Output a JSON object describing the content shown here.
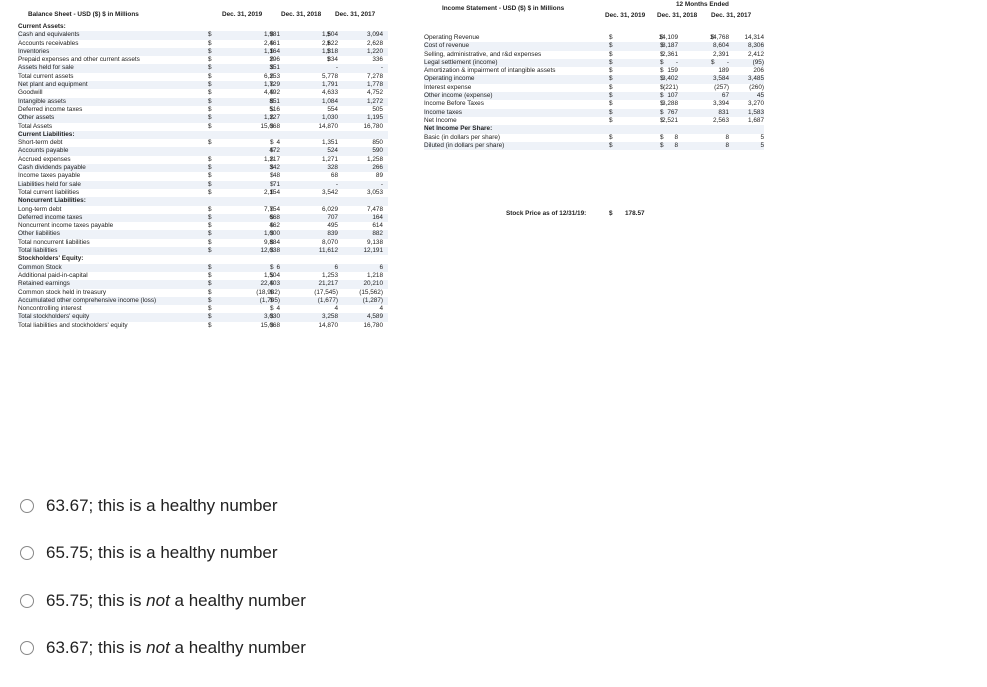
{
  "balance_sheet": {
    "title": "Balance Sheet - USD ($) $ in Millions",
    "columns": [
      "Dec. 31, 2019",
      "Dec. 31, 2018",
      "Dec. 31, 2017"
    ],
    "rows": [
      {
        "label": "Current Assets:",
        "section": true
      },
      {
        "label": "Cash and equivalents",
        "d": [
          "$",
          "$",
          "$"
        ],
        "v": [
          "1,981",
          "1,504",
          "3,094"
        ]
      },
      {
        "label": "Accounts receivables",
        "d": [
          "$",
          "$",
          "$"
        ],
        "v": [
          "2,461",
          "2,622",
          "2,628"
        ]
      },
      {
        "label": "Inventories",
        "d": [
          "$",
          "$",
          "$"
        ],
        "v": [
          "1,164",
          "1,318",
          "1,220"
        ]
      },
      {
        "label": "Prepaid expenses and other current assets",
        "d": [
          "$",
          "$",
          "$"
        ],
        "v": [
          "296",
          "334",
          "336"
        ]
      },
      {
        "label": "Assets held for sale",
        "d": [
          "$",
          "$",
          ""
        ],
        "v": [
          "351",
          "-",
          "-"
        ]
      },
      {
        "label": "Total current assets",
        "d": [
          "$",
          "$",
          ""
        ],
        "v": [
          "6,253",
          "5,778",
          "7,278"
        ]
      },
      {
        "label": "Net plant and equipment",
        "d": [
          "$",
          "$",
          ""
        ],
        "v": [
          "1,729",
          "1,791",
          "1,778"
        ]
      },
      {
        "label": "Goodwill",
        "d": [
          "$",
          "$",
          ""
        ],
        "v": [
          "4,492",
          "4,633",
          "4,752"
        ]
      },
      {
        "label": "Intangible assets",
        "d": [
          "$",
          "$",
          ""
        ],
        "v": [
          "851",
          "1,084",
          "1,272"
        ]
      },
      {
        "label": "Deferred income taxes",
        "d": [
          "$",
          "$",
          ""
        ],
        "v": [
          "516",
          "554",
          "505"
        ]
      },
      {
        "label": "Other assets",
        "d": [
          "$",
          "$",
          ""
        ],
        "v": [
          "1,227",
          "1,030",
          "1,195"
        ]
      },
      {
        "label": "Total Assets",
        "d": [
          "$",
          "$",
          ""
        ],
        "v": [
          "15,068",
          "14,870",
          "16,780"
        ]
      },
      {
        "label": "Current Liabilities:",
        "section": true
      },
      {
        "label": "Short-term debt",
        "d": [
          "$",
          "$",
          ""
        ],
        "v": [
          "4",
          "1,351",
          "850"
        ]
      },
      {
        "label": "Accounts payable",
        "d": [
          "",
          "$",
          ""
        ],
        "v": [
          "472",
          "524",
          "590"
        ]
      },
      {
        "label": "Accrued expenses",
        "d": [
          "$",
          "$",
          ""
        ],
        "v": [
          "1,217",
          "1,271",
          "1,258"
        ]
      },
      {
        "label": "Cash dividends payable",
        "d": [
          "$",
          "$",
          ""
        ],
        "v": [
          "342",
          "328",
          "266"
        ]
      },
      {
        "label": "Income taxes payable",
        "d": [
          "$",
          "$",
          ""
        ],
        "v": [
          "48",
          "68",
          "89"
        ]
      },
      {
        "label": "Liabilities held for sale",
        "d": [
          "$",
          "$",
          ""
        ],
        "v": [
          "71",
          "-",
          "-"
        ]
      },
      {
        "label": "Total current liabilities",
        "d": [
          "$",
          "$",
          ""
        ],
        "v": [
          "2,154",
          "3,542",
          "3,053"
        ]
      },
      {
        "label": "Noncurrent Liabilities:",
        "section": true
      },
      {
        "label": "Long-term debt",
        "d": [
          "$",
          "$",
          ""
        ],
        "v": [
          "7,754",
          "6,029",
          "7,478"
        ]
      },
      {
        "label": "Deferred income taxes",
        "d": [
          "$",
          "$",
          ""
        ],
        "v": [
          "668",
          "707",
          "164"
        ]
      },
      {
        "label": "Noncurrent income taxes payable",
        "d": [
          "$",
          "$",
          ""
        ],
        "v": [
          "462",
          "495",
          "614"
        ]
      },
      {
        "label": "Other liabilities",
        "d": [
          "$",
          "$",
          ""
        ],
        "v": [
          "1,000",
          "839",
          "882"
        ]
      },
      {
        "label": "Total noncurrent liabilities",
        "d": [
          "$",
          "$",
          ""
        ],
        "v": [
          "9,884",
          "8,070",
          "9,138"
        ]
      },
      {
        "label": "Total liabilities",
        "d": [
          "$",
          "$",
          ""
        ],
        "v": [
          "12,038",
          "11,612",
          "12,191"
        ]
      },
      {
        "label": "Stockholders' Equity:",
        "section": true
      },
      {
        "label": "Common Stock",
        "d": [
          "$",
          "$",
          ""
        ],
        "v": [
          "6",
          "6",
          "6"
        ]
      },
      {
        "label": "Additional paid-in-capital",
        "d": [
          "$",
          "$",
          ""
        ],
        "v": [
          "1,504",
          "1,253",
          "1,218"
        ]
      },
      {
        "label": "Retained earnings",
        "d": [
          "$",
          "$",
          ""
        ],
        "v": [
          "22,403",
          "21,217",
          "20,210"
        ]
      },
      {
        "label": "Common stock held in treasury",
        "d": [
          "$",
          "$",
          ""
        ],
        "v": [
          "(18,982)",
          "(17,545)",
          "(15,562)"
        ]
      },
      {
        "label": "Accumulated other comprehensive income (loss)",
        "d": [
          "$",
          "$",
          ""
        ],
        "v": [
          "(1,705)",
          "(1,677)",
          "(1,287)"
        ]
      },
      {
        "label": "Noncontrolling interest",
        "d": [
          "$",
          "$",
          ""
        ],
        "v": [
          "4",
          "4",
          "4"
        ]
      },
      {
        "label": "Total stockholders' equity",
        "d": [
          "$",
          "$",
          ""
        ],
        "v": [
          "3,030",
          "3,258",
          "4,589"
        ]
      },
      {
        "label": "Total liabilities and stockholders' equity",
        "d": [
          "$",
          "$",
          ""
        ],
        "v": [
          "15,068",
          "14,870",
          "16,780"
        ]
      }
    ]
  },
  "income_statement": {
    "title": "Income Statement - USD ($) $ in Millions",
    "period_header": "12 Months Ended",
    "columns": [
      "Dec. 31, 2019",
      "Dec. 31, 2018",
      "Dec. 31, 2017"
    ],
    "rows": [
      {
        "label": "Operating Revenue",
        "d": [
          "$",
          "$",
          "$"
        ],
        "v": [
          "14,109",
          "14,768",
          "14,314"
        ]
      },
      {
        "label": "Cost of revenue",
        "d": [
          "$",
          "$",
          ""
        ],
        "v": [
          "8,187",
          "8,604",
          "8,306"
        ]
      },
      {
        "label": "Selling, administrative, and r&d expenses",
        "d": [
          "$",
          "$",
          ""
        ],
        "v": [
          "2,361",
          "2,391",
          "2,412"
        ]
      },
      {
        "label": "Legal settlement (income)",
        "d": [
          "$",
          "$",
          "$"
        ],
        "v": [
          "-",
          "-",
          "(95)"
        ]
      },
      {
        "label": "Amortization & impairment of intangible assets",
        "d": [
          "$",
          "$",
          ""
        ],
        "v": [
          "159",
          "189",
          "206"
        ]
      },
      {
        "label": "Operating income",
        "d": [
          "$",
          "$",
          ""
        ],
        "v": [
          "3,402",
          "3,584",
          "3,485"
        ]
      },
      {
        "label": "Interest expense",
        "d": [
          "$",
          "$",
          ""
        ],
        "v": [
          "(221)",
          "(257)",
          "(260)"
        ]
      },
      {
        "label": "Other income (expense)",
        "d": [
          "$",
          "$",
          ""
        ],
        "v": [
          "107",
          "67",
          "45"
        ]
      },
      {
        "label": "Income Before Taxes",
        "d": [
          "$",
          "$",
          ""
        ],
        "v": [
          "3,288",
          "3,394",
          "3,270"
        ]
      },
      {
        "label": "Income taxes",
        "d": [
          "$",
          "$",
          ""
        ],
        "v": [
          "767",
          "831",
          "1,583"
        ]
      },
      {
        "label": "Net Income",
        "d": [
          "$",
          "$",
          ""
        ],
        "v": [
          "2,521",
          "2,563",
          "1,687"
        ]
      },
      {
        "label": "Net Income Per Share:",
        "section": true
      },
      {
        "label": "Basic (in dollars per share)",
        "d": [
          "$",
          "$",
          ""
        ],
        "v": [
          "8",
          "8",
          "5"
        ]
      },
      {
        "label": "Diluted (in dollars per share)",
        "d": [
          "$",
          "$",
          ""
        ],
        "v": [
          "8",
          "8",
          "5"
        ]
      }
    ],
    "stock_price_label": "Stock Price as of 12/31/19:",
    "stock_price_dollar": "$",
    "stock_price_value": "178.57"
  },
  "answer_options": [
    {
      "number": "63.67",
      "prefix": "; this is ",
      "emph": "",
      "suffix": "a healthy number"
    },
    {
      "number": "65.75",
      "prefix": "; this is ",
      "emph": "",
      "suffix": "a healthy number"
    },
    {
      "number": "65.75",
      "prefix": "; this is ",
      "emph": "not",
      "suffix": " a healthy number"
    },
    {
      "number": "63.67",
      "prefix": "; this is ",
      "emph": "not",
      "suffix": " a healthy number"
    }
  ]
}
